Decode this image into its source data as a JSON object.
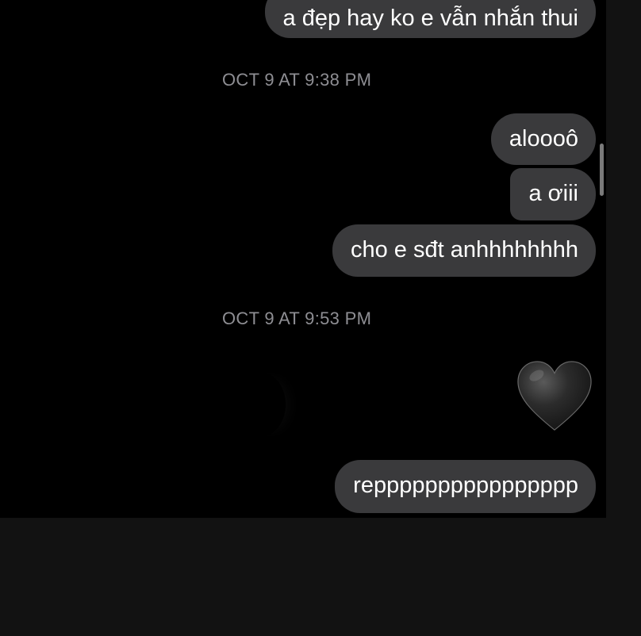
{
  "messages": [
    {
      "type": "outgoing",
      "text": "a đẹp hay ko e vẫn nhắn thui"
    },
    {
      "type": "timestamp",
      "text": "OCT 9 AT 9:38 PM"
    },
    {
      "type": "outgoing",
      "text": "aloooô"
    },
    {
      "type": "outgoing",
      "text": "a ơiii"
    },
    {
      "type": "outgoing",
      "text": "cho e sđt anhhhhhhhh"
    },
    {
      "type": "timestamp",
      "text": "OCT 9 AT 9:53 PM"
    },
    {
      "type": "emoji",
      "icon": "black-heart-icon"
    },
    {
      "type": "outgoing",
      "text": "repppppppppppppppp"
    }
  ],
  "colors": {
    "chat_background": "#000000",
    "outgoing_bubble": "#3a3a3c",
    "timestamp_text": "#8e8e93",
    "heart": "#2b2b2b"
  }
}
